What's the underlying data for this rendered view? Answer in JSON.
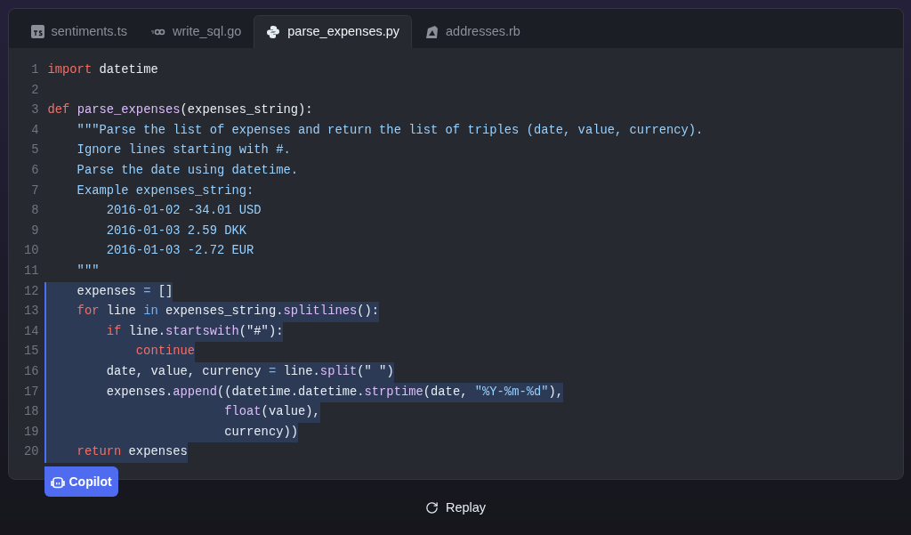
{
  "tabs": [
    {
      "label": "sentiments.ts",
      "kind": "ts",
      "selected": false
    },
    {
      "label": "write_sql.go",
      "kind": "go",
      "selected": false
    },
    {
      "label": "parse_expenses.py",
      "kind": "py",
      "selected": true
    },
    {
      "label": "addresses.rb",
      "kind": "rb",
      "selected": false
    }
  ],
  "code": [
    {
      "number": "1",
      "kind": "flat",
      "highlighted": false,
      "tokens": [
        {
          "text": "import",
          "kind": "kw"
        },
        {
          "text": " datetime",
          "kind": "plain"
        }
      ]
    },
    {
      "number": "2",
      "kind": "flat",
      "highlighted": false
    },
    {
      "number": "3",
      "kind": "flat",
      "highlighted": false,
      "tokens": [
        {
          "text": "def ",
          "kind": "kw"
        },
        {
          "text": "parse_expenses",
          "kind": "fn"
        },
        {
          "text": "(expenses_string):",
          "kind": "plain"
        }
      ]
    },
    {
      "number": "4",
      "kind": "indented",
      "highlighted": false,
      "tokens": [
        {
          "text": "\"\"\"Parse the list of expenses and return the list of triples (date, value, currency).",
          "kind": "doc"
        }
      ]
    },
    {
      "number": "5",
      "kind": "indented",
      "highlighted": false,
      "tokens": [
        {
          "text": "Ignore lines starting with #.",
          "kind": "doc"
        }
      ]
    },
    {
      "number": "6",
      "kind": "indented",
      "highlighted": false,
      "tokens": [
        {
          "text": "Parse the date using datetime.",
          "kind": "doc"
        }
      ]
    },
    {
      "number": "7",
      "kind": "indented",
      "highlighted": false,
      "tokens": [
        {
          "text": "Example expenses_string:",
          "kind": "doc"
        }
      ]
    },
    {
      "number": "8",
      "kind": "nested",
      "highlighted": false,
      "tokens": [
        {
          "text": "2016-01-02 -34.01 USD",
          "kind": "doc"
        }
      ]
    },
    {
      "number": "9",
      "kind": "nested",
      "highlighted": false,
      "tokens": [
        {
          "text": "2016-01-03 2.59 DKK",
          "kind": "doc"
        }
      ]
    },
    {
      "number": "10",
      "kind": "nested",
      "highlighted": false,
      "tokens": [
        {
          "text": "2016-01-03 -2.72 EUR",
          "kind": "doc"
        }
      ]
    },
    {
      "number": "11",
      "kind": "indented",
      "highlighted": false,
      "tokens": [
        {
          "text": "\"\"\"",
          "kind": "doc"
        }
      ]
    },
    {
      "number": "12",
      "kind": "indented",
      "highlighted": true,
      "tokens": [
        {
          "text": "expenses ",
          "kind": "plain"
        },
        {
          "text": "=",
          "kind": "op"
        },
        {
          "text": " []",
          "kind": "plain"
        }
      ]
    },
    {
      "number": "13",
      "kind": "indented",
      "highlighted": true,
      "tokens": [
        {
          "text": "for",
          "kind": "kw"
        },
        {
          "text": " line ",
          "kind": "plain"
        },
        {
          "text": "in",
          "kind": "op"
        },
        {
          "text": " expenses_string.",
          "kind": "plain"
        },
        {
          "text": "splitlines",
          "kind": "fn"
        },
        {
          "text": "():",
          "kind": "plain"
        }
      ]
    },
    {
      "number": "14",
      "kind": "nested",
      "highlighted": true,
      "tokens": [
        {
          "text": "if",
          "kind": "kw"
        },
        {
          "text": " line.",
          "kind": "plain"
        },
        {
          "text": "startswith",
          "kind": "fn"
        },
        {
          "text": "(\"#\"):",
          "kind": "plain"
        }
      ]
    },
    {
      "number": "15",
      "kind": "deep",
      "highlighted": true,
      "tokens": [
        {
          "text": "continue",
          "kind": "kw"
        }
      ]
    },
    {
      "number": "16",
      "kind": "nested",
      "highlighted": true,
      "tokens": [
        {
          "text": "date, value, currency ",
          "kind": "plain"
        },
        {
          "text": "=",
          "kind": "op"
        },
        {
          "text": " line.",
          "kind": "plain"
        },
        {
          "text": "split",
          "kind": "fn"
        },
        {
          "text": "(\" \")",
          "kind": "plain"
        }
      ]
    },
    {
      "number": "17",
      "kind": "nested",
      "highlighted": true,
      "tokens": [
        {
          "text": "expenses.",
          "kind": "plain"
        },
        {
          "text": "append",
          "kind": "fn"
        },
        {
          "text": "((datetime.datetime.",
          "kind": "plain"
        },
        {
          "text": "strptime",
          "kind": "fn"
        },
        {
          "text": "(date, ",
          "kind": "plain"
        },
        {
          "text": "\"%Y-%m-%d\"",
          "kind": "str"
        },
        {
          "text": "),",
          "kind": "plain"
        }
      ]
    },
    {
      "number": "18",
      "kind": "aligned",
      "highlighted": true,
      "tokens": [
        {
          "text": "float",
          "kind": "fn"
        },
        {
          "text": "(value),",
          "kind": "plain"
        }
      ]
    },
    {
      "number": "19",
      "kind": "aligned",
      "highlighted": true,
      "tokens": [
        {
          "text": "currency))",
          "kind": "plain"
        }
      ]
    },
    {
      "number": "20",
      "kind": "indented",
      "highlighted": true,
      "tokens": [
        {
          "text": "return",
          "kind": "kw"
        },
        {
          "text": " expenses",
          "kind": "plain"
        }
      ]
    }
  ],
  "badge": {
    "label": "Copilot"
  },
  "replay": {
    "label": "Replay"
  }
}
